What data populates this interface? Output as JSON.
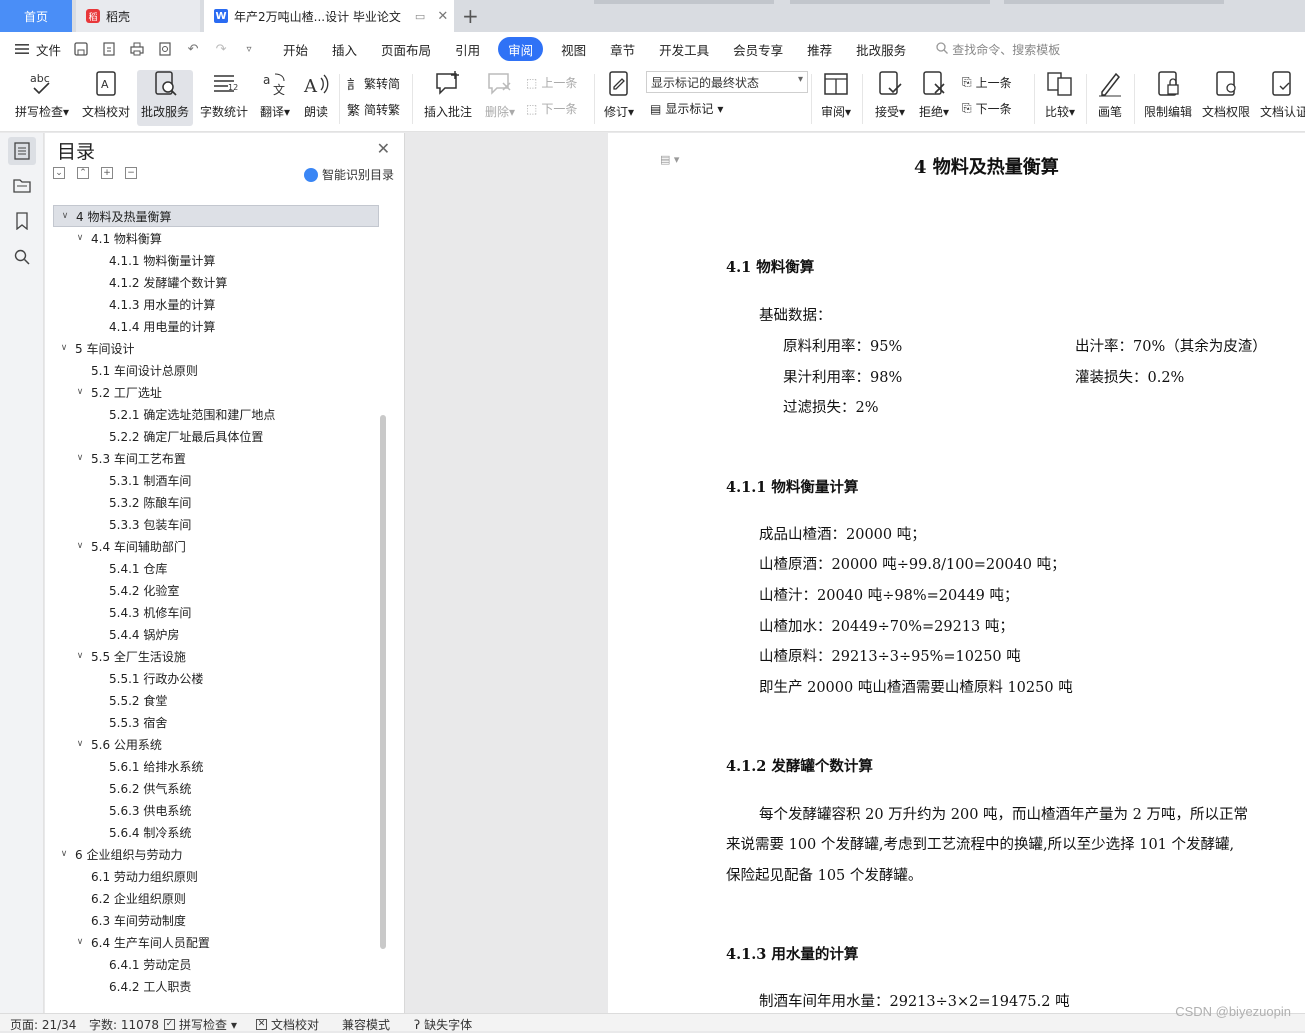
{
  "tabs": {
    "home": "首页",
    "docer": "稻壳",
    "doc_title": "年产2万吨山楂...设计 毕业论文"
  },
  "menu": {
    "file": "文件",
    "tabs": [
      "开始",
      "插入",
      "页面布局",
      "引用",
      "审阅",
      "视图",
      "章节",
      "开发工具",
      "会员专享",
      "推荐",
      "批改服务"
    ],
    "active_tab": "审阅",
    "search_placeholder": "查找命令、搜索模板"
  },
  "ribbon": {
    "spell_check": "拼写检查",
    "doc_proofread": "文档校对",
    "revision_service": "批改服务",
    "word_count": "字数统计",
    "translate": "翻译",
    "read_aloud": "朗读",
    "trad_to_simp": "繁转简",
    "simp_to_trad": "简转繁",
    "insert_comment": "插入批注",
    "delete": "删除",
    "prev_comment": "上一条",
    "next_comment": "下一条",
    "track_changes": "修订",
    "markup_state": "显示标记的最终状态",
    "show_markup": "显示标记",
    "review": "审阅",
    "accept": "接受",
    "reject": "拒绝",
    "prev_change": "上一条",
    "next_change": "下一条",
    "compare": "比较",
    "pen": "画笔",
    "restrict_edit": "限制编辑",
    "doc_permission": "文档权限",
    "doc_certify": "文档认证"
  },
  "toc": {
    "title": "目录",
    "smart_button": "智能识别目录",
    "items": [
      {
        "text": "4   物料及热量衡算",
        "level": 0,
        "expand": true,
        "highlight": true
      },
      {
        "text": "4.1 物料衡算",
        "level": 1,
        "expand": true
      },
      {
        "text": "4.1.1 物料衡量计算",
        "level": 2
      },
      {
        "text": "4.1.2 发酵罐个数计算",
        "level": 2
      },
      {
        "text": "4.1.3 用水量的计算",
        "level": 2
      },
      {
        "text": "4.1.4 用电量的计算",
        "level": 2
      },
      {
        "text": "5   车间设计",
        "level": 0,
        "expand": true
      },
      {
        "text": "5.1 车间设计总原则",
        "level": 1
      },
      {
        "text": "5.2  工厂选址",
        "level": 1,
        "expand": true
      },
      {
        "text": "5.2.1  确定选址范围和建厂地点",
        "level": 2
      },
      {
        "text": "5.2.2  确定厂址最后具体位置",
        "level": 2
      },
      {
        "text": "5.3  车间工艺布置",
        "level": 1,
        "expand": true
      },
      {
        "text": "5.3.1 制酒车间",
        "level": 2
      },
      {
        "text": "5.3.2 陈酿车间",
        "level": 2
      },
      {
        "text": "5.3.3 包装车间",
        "level": 2
      },
      {
        "text": "5.4 车间辅助部门",
        "level": 1,
        "expand": true
      },
      {
        "text": "5.4.1 仓库",
        "level": 2
      },
      {
        "text": "5.4.2 化验室",
        "level": 2
      },
      {
        "text": "5.4.3 机修车间",
        "level": 2
      },
      {
        "text": "5.4.4 锅炉房",
        "level": 2
      },
      {
        "text": "5.5 全厂生活设施",
        "level": 1,
        "expand": true
      },
      {
        "text": "5.5.1 行政办公楼",
        "level": 2
      },
      {
        "text": "5.5.2 食堂",
        "level": 2
      },
      {
        "text": "5.5.3 宿舍",
        "level": 2
      },
      {
        "text": "5.6 公用系统",
        "level": 1,
        "expand": true
      },
      {
        "text": "5.6.1 给排水系统",
        "level": 2
      },
      {
        "text": "5.6.2 供气系统",
        "level": 2
      },
      {
        "text": "5.6.3 供电系统",
        "level": 2
      },
      {
        "text": "5.6.4 制冷系统",
        "level": 2
      },
      {
        "text": "6   企业组织与劳动力",
        "level": 0,
        "expand": true
      },
      {
        "text": "6.1 劳动力组织原则",
        "level": 1
      },
      {
        "text": "6.2 企业组织原则",
        "level": 1
      },
      {
        "text": "6.3 车间劳动制度",
        "level": 1
      },
      {
        "text": "6.4 生产车间人员配置",
        "level": 1,
        "expand": true
      },
      {
        "text": "6.4.1  劳动定员",
        "level": 2
      },
      {
        "text": "6.4.2  工人职责",
        "level": 2
      }
    ]
  },
  "document": {
    "title": "4   物料及热量衡算",
    "s41": "4.1 物料衡算",
    "basic": "基础数据：",
    "r1_left": "原料利用率：95%",
    "r1_right": "出汁率：70%（其余为皮渣）",
    "r2_left": "果汁利用率：98%",
    "r2_right": "灌装损失：0.2%",
    "r3_left": "过滤损失：2%",
    "s411": "4.1.1 物料衡量计算",
    "calc": [
      "成品山楂酒：20000 吨；",
      "山楂原酒：20000 吨÷99.8/100=20040 吨；",
      "山楂汁：20040 吨÷98%=20449 吨；",
      "山楂加水：20449÷70%=29213 吨；",
      "山楂原料：29213÷3÷95%=10250 吨",
      "即生产 20000 吨山楂酒需要山楂原料 10250 吨"
    ],
    "s412": "4.1.2 发酵罐个数计算",
    "para": [
      "每个发酵罐容积 20 万升约为 200 吨，而山楂酒年产量为 2 万吨，所以正常",
      "来说需要 100 个发酵罐,考虑到工艺流程中的换罐,所以至少选择 101 个发酵罐,",
      "保险起见配备 105 个发酵罐。"
    ],
    "s413": "4.1.3 用水量的计算",
    "water": "制酒车间年用水量：29213÷3×2=19475.2 吨"
  },
  "status": {
    "page": "页面: 21/34",
    "words": "字数: 11078",
    "spell": "拼写检查",
    "proof": "文档校对",
    "compat": "兼容模式",
    "missing_font": "缺失字体"
  },
  "watermark": "CSDN @biyezuopin"
}
